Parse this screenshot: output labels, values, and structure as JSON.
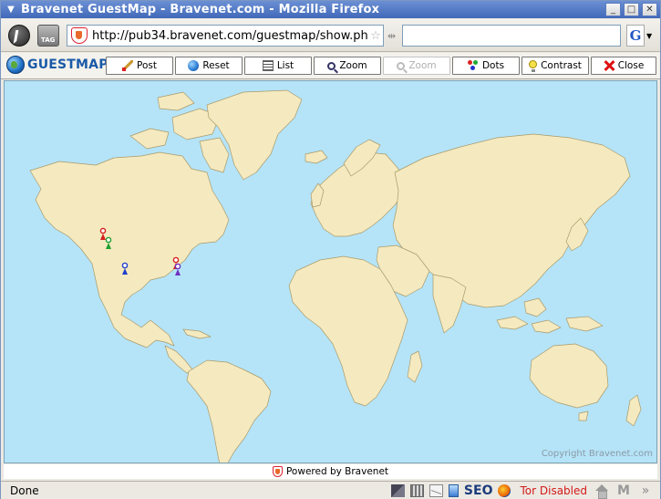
{
  "window": {
    "title": "Bravenet GuestMap - Bravenet.com - Mozilla Firefox",
    "minimize": "_",
    "maximize": "□",
    "close": "✕"
  },
  "navbar": {
    "tag_label": "TAG",
    "url": "http://pub34.bravenet.com/guestmap/show.ph",
    "search_value": "",
    "search_engine_letter": "G"
  },
  "guestmap": {
    "logo_text": "GUESTMAP",
    "buttons": [
      {
        "label": "Post",
        "icon": "pencil-icon",
        "enabled": true
      },
      {
        "label": "Reset",
        "icon": "globe-icon",
        "enabled": true
      },
      {
        "label": "List",
        "icon": "list-icon",
        "enabled": true
      },
      {
        "label": "Zoom",
        "icon": "zoom-in-icon",
        "enabled": true
      },
      {
        "label": "Zoom",
        "icon": "zoom-out-icon",
        "enabled": false
      },
      {
        "label": "Dots",
        "icon": "dots-icon",
        "enabled": true
      },
      {
        "label": "Contrast",
        "icon": "lightbulb-icon",
        "enabled": true
      },
      {
        "label": "Close",
        "icon": "close-icon",
        "enabled": true
      }
    ]
  },
  "map": {
    "ocean_color": "#b5e4f8",
    "land_color": "#f5e9bf",
    "copyright": "Copyright Bravenet.com",
    "markers": [
      {
        "color": "#d42020"
      },
      {
        "color": "#20a030"
      },
      {
        "color": "#2040c8"
      },
      {
        "color": "#d42020"
      },
      {
        "color": "#7030c0"
      }
    ]
  },
  "footer": {
    "powered_by": "Powered by Bravenet"
  },
  "statusbar": {
    "status": "Done",
    "seo_label": "SEO",
    "tor_status": "Tor Disabled",
    "tor_color": "#d21a1a"
  }
}
